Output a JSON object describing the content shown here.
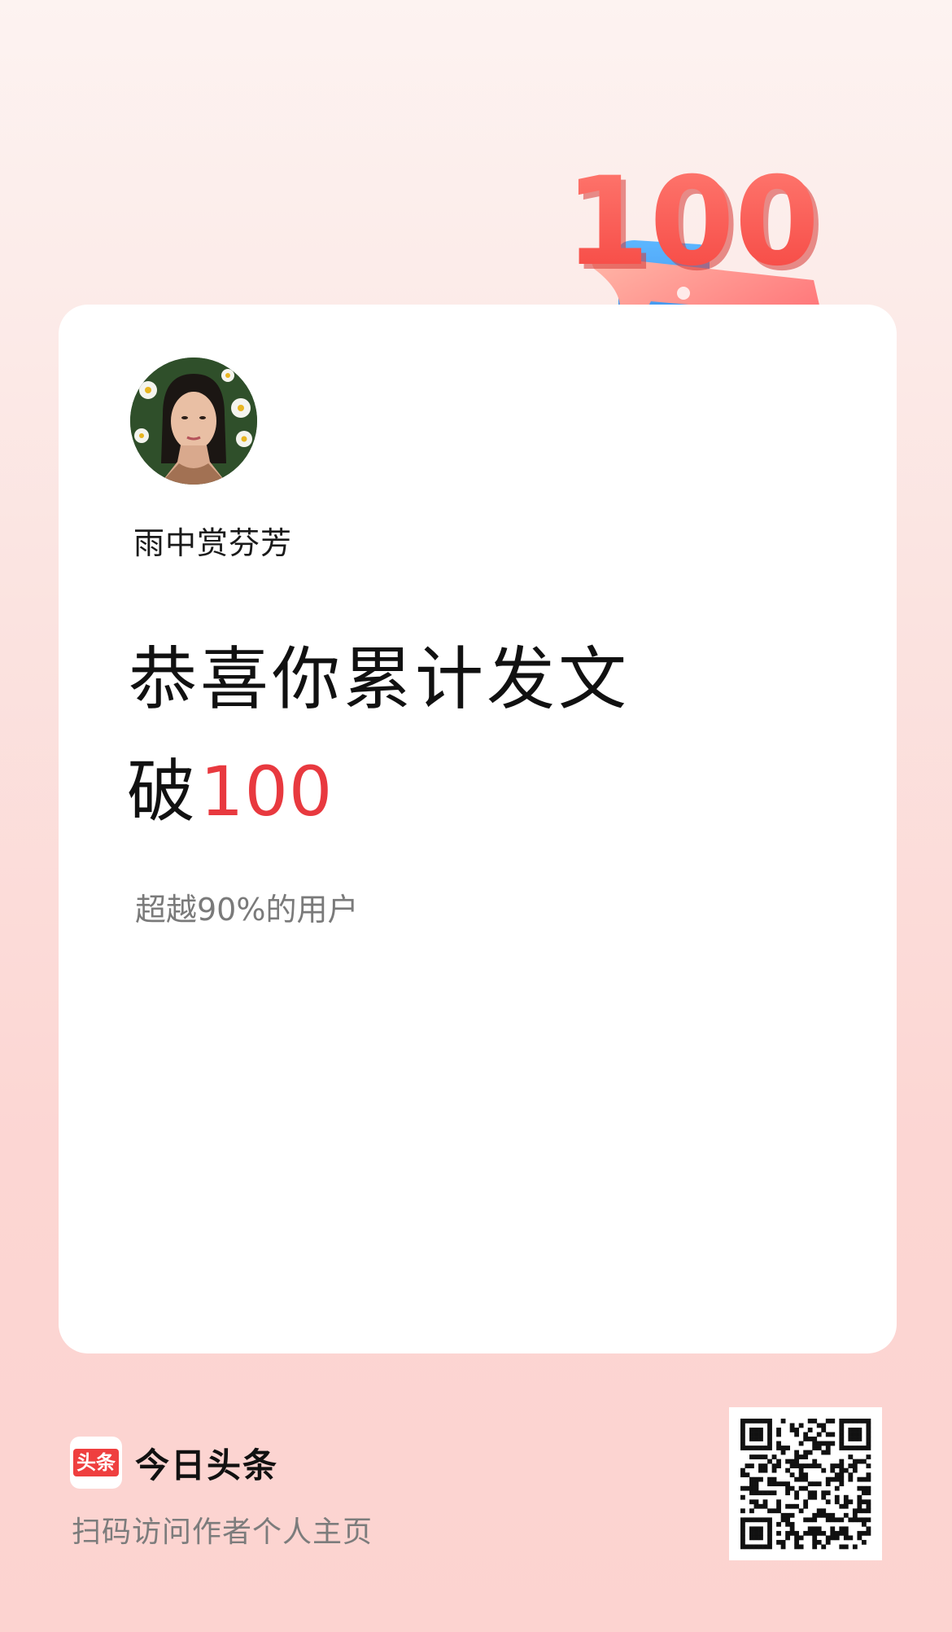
{
  "card": {
    "username": "雨中赏芬芳",
    "headline_line1": "恭喜你累计发文",
    "headline_prefix": "破",
    "headline_number": "100",
    "subline": "超越90%的用户"
  },
  "decoration": {
    "badge_number": "100"
  },
  "footer": {
    "logo_text": "头条",
    "brand_name": "今日头条",
    "scan_text": "扫码访问作者个人主页"
  },
  "colors": {
    "accent": "#e8393f",
    "brand_red": "#ef3f3f",
    "background_top": "#fdf3f1",
    "background_bottom": "#fcd3d0"
  },
  "icons": {
    "avatar": "avatar-photo",
    "decoration": "3d-100-scroll-paper-plane",
    "qr": "qr-code-icon"
  }
}
